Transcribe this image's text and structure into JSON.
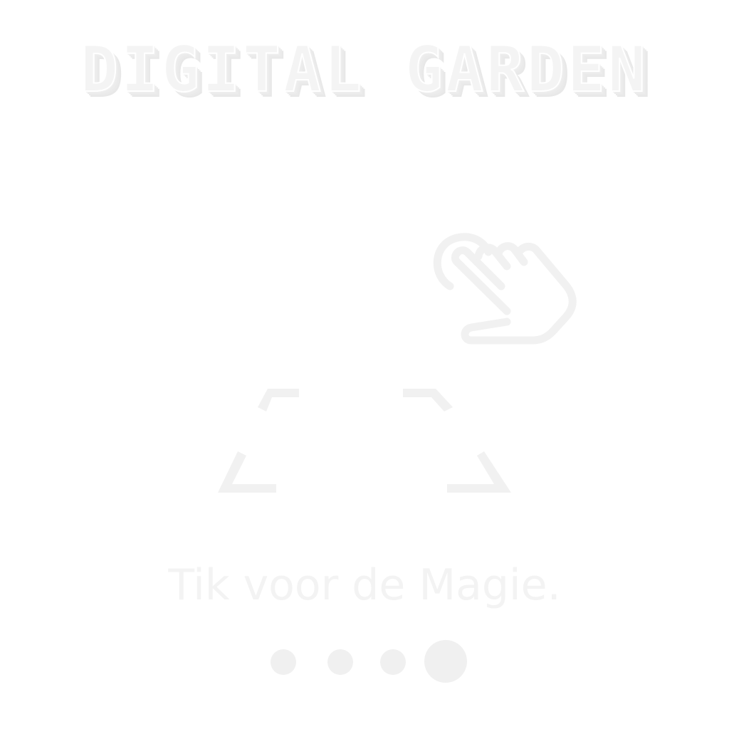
{
  "header": {
    "logo_text": "DIGITAL GARDEN"
  },
  "hint": {
    "icon": "tap-gesture-icon",
    "frame_icon": "scan-frame-icon"
  },
  "prompt": {
    "text": "Tik voor de Magie."
  },
  "pagination": {
    "total": 4,
    "active_index": 4
  },
  "colors": {
    "background": "#ffffff",
    "foreground": "#f2f2f2"
  }
}
